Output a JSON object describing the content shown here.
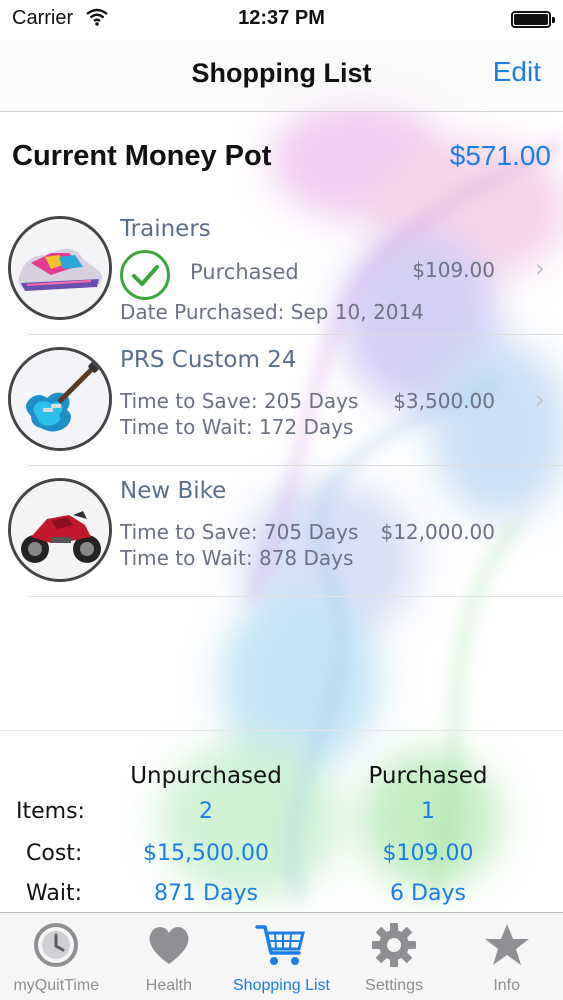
{
  "status_bar": {
    "carrier": "Carrier",
    "time": "12:37 PM"
  },
  "nav": {
    "title": "Shopping List",
    "edit_label": "Edit"
  },
  "money_pot": {
    "label": "Current Money Pot",
    "value": "$571.00"
  },
  "items": [
    {
      "name": "Trainers",
      "status": "Purchased",
      "price": "$109.00",
      "date_purchased": "Date Purchased: Sep 10, 2014",
      "image_icon": "trainers-image"
    },
    {
      "name": "PRS Custom 24",
      "time_to_save": "Time to Save: 205 Days",
      "time_to_wait": "Time to Wait:  172 Days",
      "price": "$3,500.00",
      "image_icon": "guitar-image"
    },
    {
      "name": "New Bike",
      "time_to_save": "Time to Save: 705 Days",
      "time_to_wait": "Time to Wait:  878 Days",
      "price": "$12,000.00",
      "image_icon": "motorbike-image"
    }
  ],
  "summary": {
    "col_unpurchased": "Unpurchased",
    "col_purchased": "Purchased",
    "rows": [
      {
        "label": "Items:",
        "unpurchased": "2",
        "purchased": "1"
      },
      {
        "label": "Cost:",
        "unpurchased": "$15,500.00",
        "purchased": "$109.00"
      },
      {
        "label": "Wait:",
        "unpurchased": "871 Days",
        "purchased": "6 Days"
      }
    ]
  },
  "tabs": [
    {
      "label": "myQuitTime",
      "icon": "clock-icon",
      "active": false
    },
    {
      "label": "Health",
      "icon": "heart-icon",
      "active": false
    },
    {
      "label": "Shopping List",
      "icon": "cart-icon",
      "active": true
    },
    {
      "label": "Settings",
      "icon": "gear-icon",
      "active": false
    },
    {
      "label": "Info",
      "icon": "star-icon",
      "active": false
    }
  ],
  "colors": {
    "accent": "#1a7ee6",
    "check": "#3ba63b"
  }
}
